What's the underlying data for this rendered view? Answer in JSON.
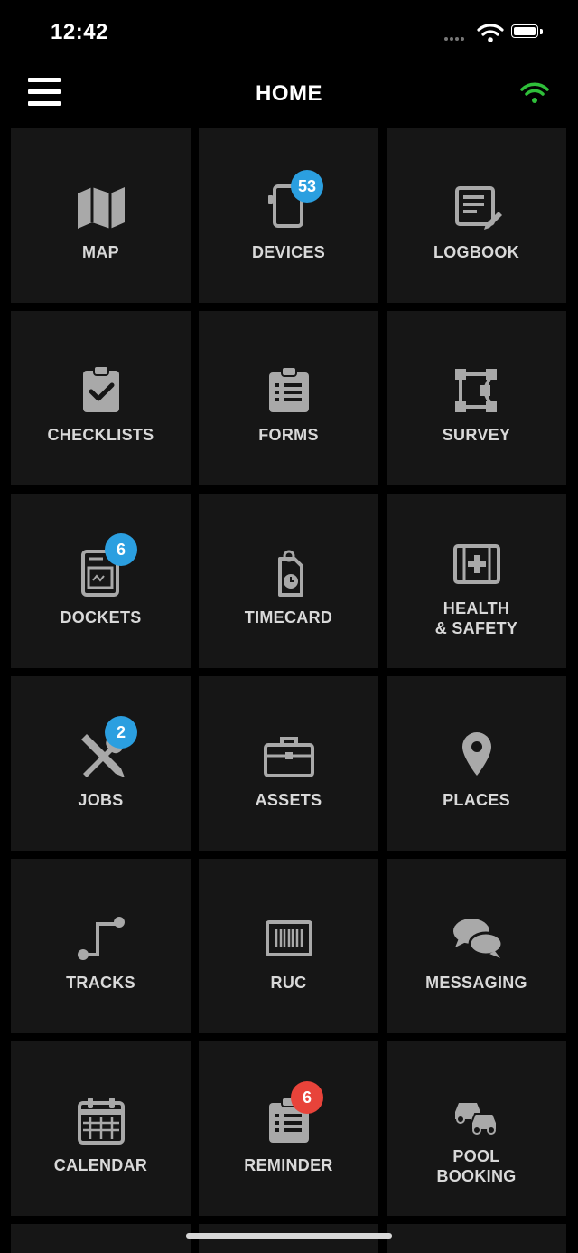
{
  "status_bar": {
    "time": "12:42"
  },
  "nav": {
    "title": "HOME",
    "connection_color": "#2fbf3a"
  },
  "colors": {
    "tile": "#161616",
    "icon": "#a9a9a9",
    "badge_blue": "#2b9fe0",
    "badge_red": "#e8433a"
  },
  "tiles": [
    {
      "label": "MAP",
      "icon": "map-icon"
    },
    {
      "label": "DEVICES",
      "icon": "tablet-icon",
      "badge": "53"
    },
    {
      "label": "LOGBOOK",
      "icon": "logbook-icon"
    },
    {
      "label": "CHECKLISTS",
      "icon": "clipboard-check-icon"
    },
    {
      "label": "FORMS",
      "icon": "form-icon"
    },
    {
      "label": "SURVEY",
      "icon": "survey-icon"
    },
    {
      "label": "DOCKETS",
      "icon": "docket-icon",
      "badge": "6"
    },
    {
      "label": "TIMECARD",
      "icon": "timecard-icon"
    },
    {
      "label_line1": "HEALTH",
      "label_line2": "& SAFETY",
      "icon": "first-aid-icon"
    },
    {
      "label": "JOBS",
      "icon": "tools-icon",
      "badge": "2"
    },
    {
      "label": "ASSETS",
      "icon": "briefcase-icon"
    },
    {
      "label": "PLACES",
      "icon": "map-pin-icon"
    },
    {
      "label": "TRACKS",
      "icon": "track-icon"
    },
    {
      "label": "RUC",
      "icon": "barcode-icon"
    },
    {
      "label": "MESSAGING",
      "icon": "chat-icon"
    },
    {
      "label": "CALENDAR",
      "icon": "calendar-icon"
    },
    {
      "label": "REMINDER",
      "icon": "reminder-icon",
      "badge": "6"
    },
    {
      "label_line1": "POOL",
      "label_line2": "BOOKING",
      "icon": "cars-icon"
    }
  ]
}
